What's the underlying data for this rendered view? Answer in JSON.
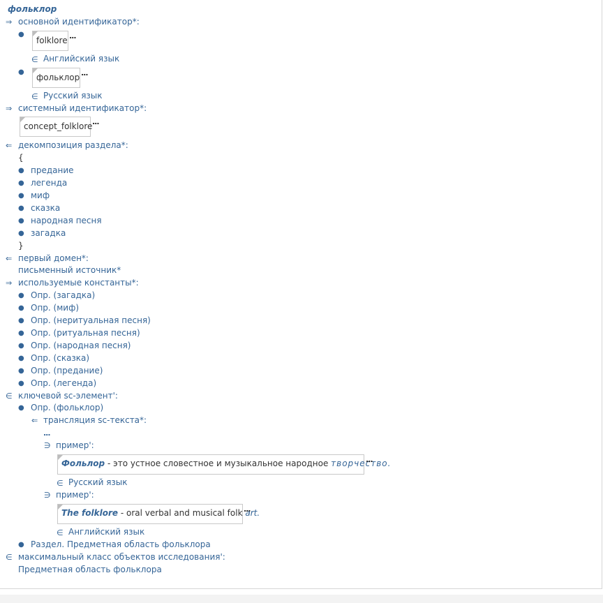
{
  "concept": {
    "title": "фольклор"
  },
  "relations": {
    "main_id": {
      "label": "основной идентификатор*:",
      "items": [
        {
          "value": "folklore",
          "lang": "Английский язык"
        },
        {
          "value": "фольклор",
          "lang": "Русский язык"
        }
      ]
    },
    "system_id": {
      "label": "системный идентификатор*:",
      "value": "concept_folklore"
    },
    "decomposition": {
      "label": "декомпозиция раздела*:",
      "open_brace": "{",
      "close_brace": "}",
      "items": [
        "предание",
        "легенда",
        "миф",
        "сказка",
        "народная песня",
        "загадка"
      ]
    },
    "first_domain": {
      "label": "первый домен*:",
      "value": "письменный источник*"
    },
    "constants": {
      "label": "используемые константы*:",
      "items": [
        "Опр. (загадка)",
        "Опр. (миф)",
        "Опр. (неритуальная песня)",
        "Опр. (ритуальная песня)",
        "Опр. (народная песня)",
        "Опр. (сказка)",
        "Опр. (предание)",
        "Опр. (легенда)"
      ]
    },
    "key_element": {
      "label": "ключевой sc-элемент':",
      "item": "Опр. (фольклор)",
      "translation_label": "трансляция sc-текста*:",
      "dots": "...",
      "example_label": "пример':",
      "example_ru": {
        "term": "Фольлор",
        "text": " - это устное словестное и музыкальное народное ",
        "link": "творчество",
        "end": ".",
        "lang": "Русский язык"
      },
      "example_en": {
        "term": "The folklore",
        "text": " - oral verbal and musical folk ",
        "link": "art",
        "end": ".",
        "lang": "Английский язык"
      },
      "section_item": "Раздел. Предметная область фольклора"
    },
    "max_class": {
      "label": "максимальный класс объектов исследования':",
      "value": "Предметная область фольклора"
    }
  },
  "symbols": {
    "arrow_right": "⇒",
    "arrow_left": "⇐",
    "element_of": "∈",
    "contains": "∋",
    "bullet": "●",
    "more": "..."
  }
}
